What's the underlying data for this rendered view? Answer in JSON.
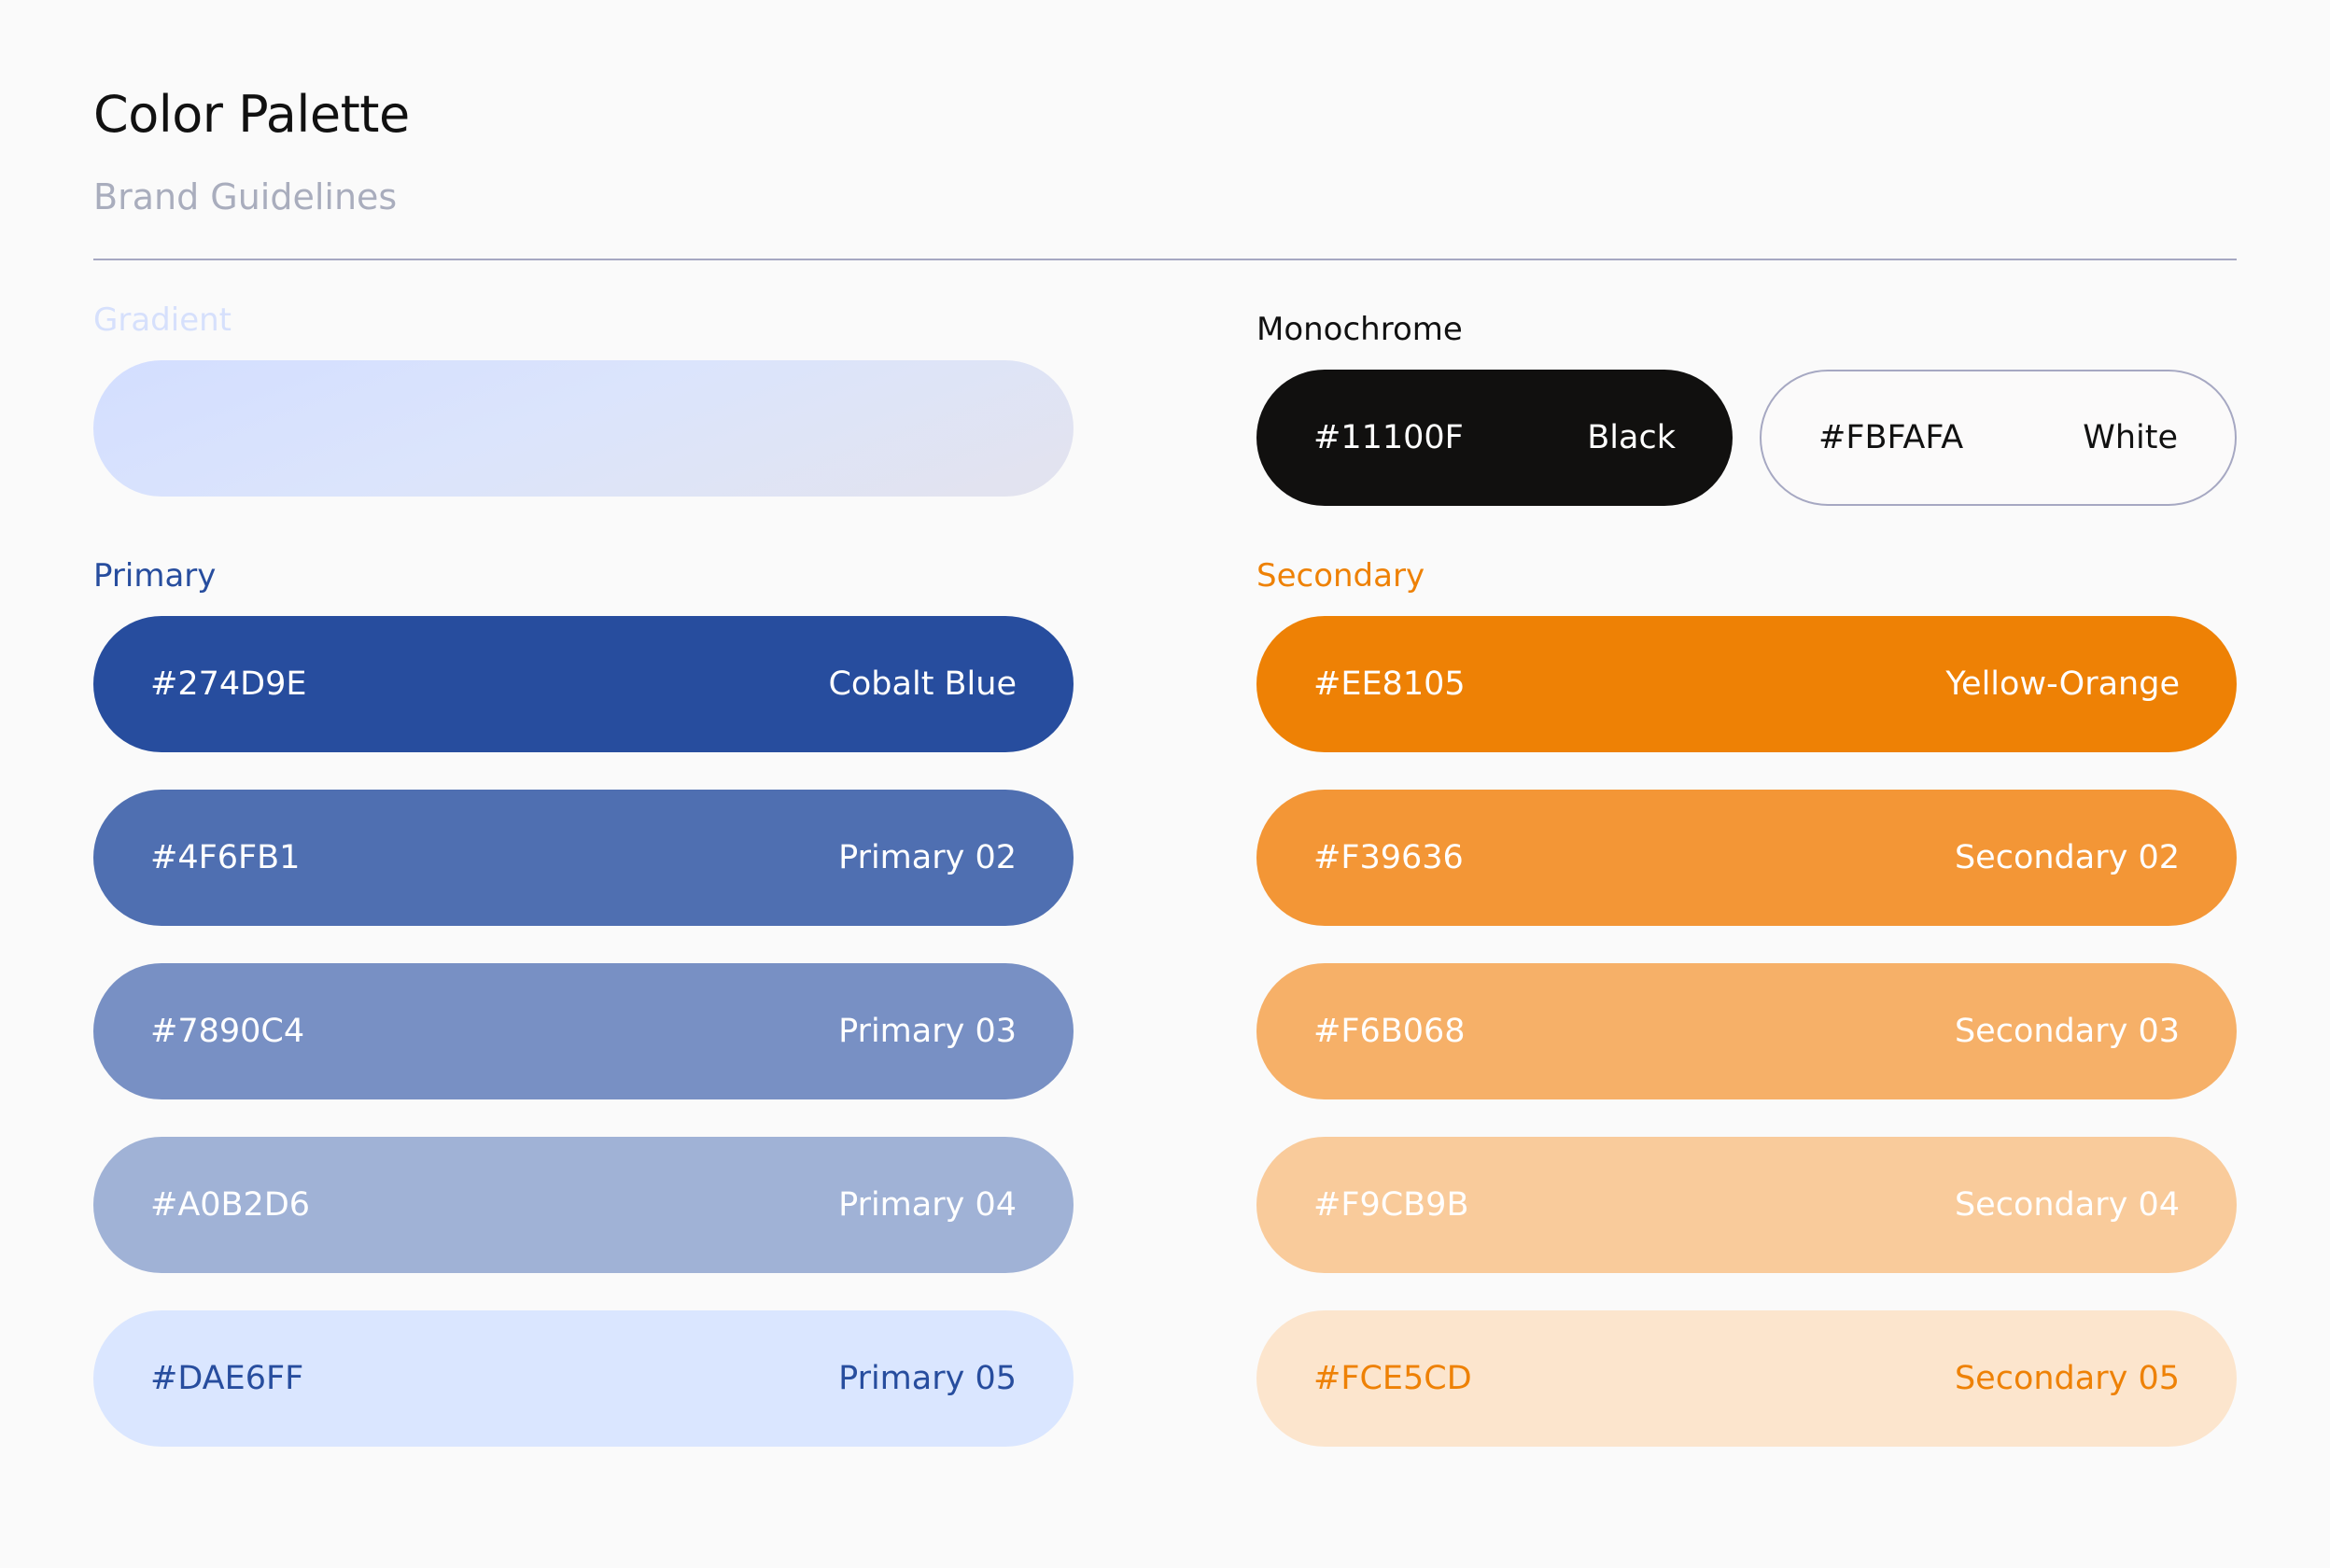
{
  "header": {
    "title": "Color Palette",
    "subtitle": "Brand Guidelines"
  },
  "gradient": {
    "label": "Gradient",
    "colors": [
      "#D3DEFF",
      "#DBE4FC",
      "#E3E3EE"
    ]
  },
  "monochrome": {
    "label": "Monochrome",
    "swatches": [
      {
        "hex": "#11100F",
        "name": "Black"
      },
      {
        "hex": "#FBFAFA",
        "name": "White"
      }
    ]
  },
  "primary": {
    "label": "Primary",
    "swatches": [
      {
        "hex": "#274D9E",
        "name": "Cobalt Blue"
      },
      {
        "hex": "#4F6FB1",
        "name": "Primary 02"
      },
      {
        "hex": "#7890C4",
        "name": "Primary 03"
      },
      {
        "hex": "#A0B2D6",
        "name": "Primary 04"
      },
      {
        "hex": "#DAE6FF",
        "name": "Primary 05"
      }
    ]
  },
  "secondary": {
    "label": "Secondary",
    "swatches": [
      {
        "hex": "#EE8105",
        "name": "Yellow-Orange"
      },
      {
        "hex": "#F39636",
        "name": "Secondary 02"
      },
      {
        "hex": "#F6B068",
        "name": "Secondary 03"
      },
      {
        "hex": "#F9CB9B",
        "name": "Secondary 04"
      },
      {
        "hex": "#FCE5CD",
        "name": "Secondary 05"
      }
    ]
  }
}
